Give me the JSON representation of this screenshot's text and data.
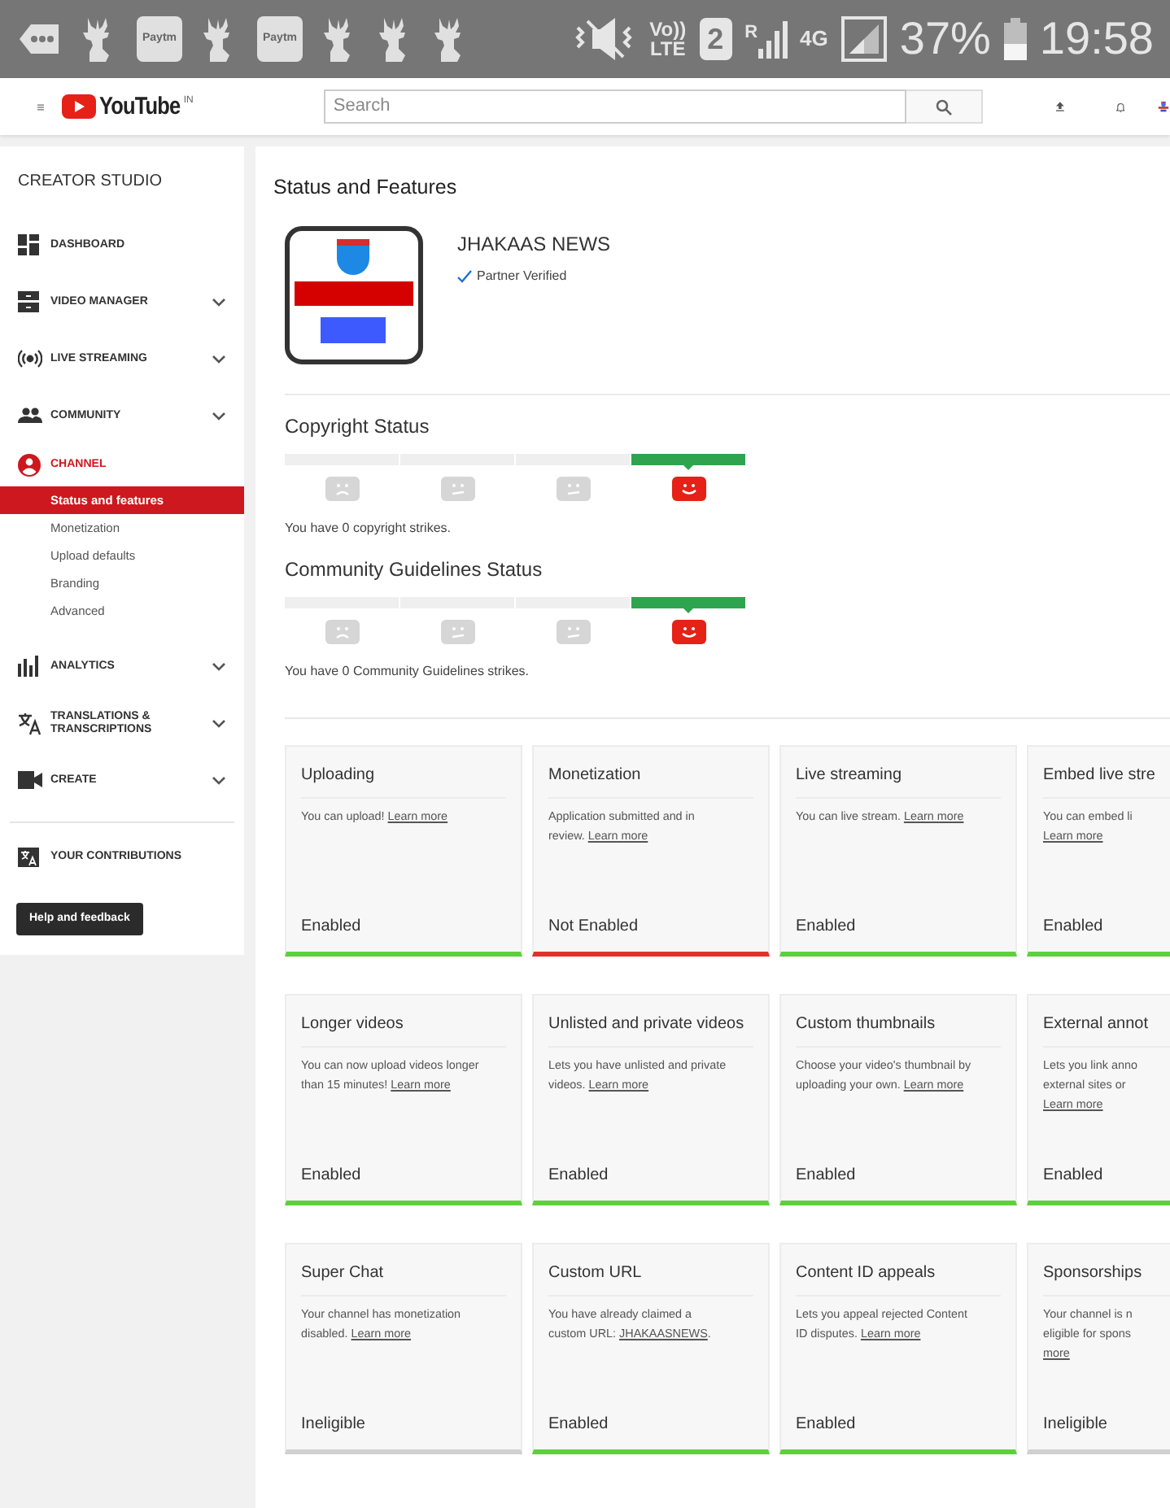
{
  "status_bar": {
    "notifications": [
      {
        "kind": "more"
      },
      {
        "kind": "deer"
      },
      {
        "kind": "paytm",
        "text": "Paytm"
      },
      {
        "kind": "deer"
      },
      {
        "kind": "paytm",
        "text": "Paytm"
      },
      {
        "kind": "deer"
      },
      {
        "kind": "deer"
      },
      {
        "kind": "deer"
      }
    ],
    "volte": [
      "Vo))",
      "LTE"
    ],
    "sim": "2",
    "roaming": "R",
    "network": "4G",
    "battery": "37%",
    "time": "19:58"
  },
  "header": {
    "logo": "YouTube",
    "region": "IN",
    "search": {
      "placeholder": "Search"
    }
  },
  "sidebar": {
    "title": "CREATOR STUDIO",
    "items": [
      {
        "label": "DASHBOARD",
        "expandable": false,
        "selected": false
      },
      {
        "label": "VIDEO MANAGER",
        "expandable": true,
        "selected": false
      },
      {
        "label": "LIVE STREAMING",
        "expandable": true,
        "selected": false
      },
      {
        "label": "COMMUNITY",
        "expandable": true,
        "selected": false
      },
      {
        "label": "CHANNEL",
        "expandable": false,
        "selected": true,
        "children": [
          {
            "label": "Status and features",
            "selected": true
          },
          {
            "label": "Monetization",
            "selected": false
          },
          {
            "label": "Upload defaults",
            "selected": false
          },
          {
            "label": "Branding",
            "selected": false
          },
          {
            "label": "Advanced",
            "selected": false
          }
        ]
      },
      {
        "label": "ANALYTICS",
        "expandable": true,
        "selected": false
      },
      {
        "label": "TRANSLATIONS & TRANSCRIPTIONS",
        "expandable": true,
        "selected": false
      },
      {
        "label": "CREATE",
        "expandable": true,
        "selected": false
      }
    ],
    "contributions": "YOUR CONTRIBUTIONS",
    "help_button": "Help and feedback"
  },
  "page": {
    "title": "Status and Features",
    "channel": {
      "name": "JHAKAAS NEWS",
      "verified": "Partner Verified"
    },
    "statuses": [
      {
        "title": "Copyright Status",
        "faces": [
          {
            "selected": false
          },
          {
            "selected": false
          },
          {
            "selected": false
          },
          {
            "selected": true
          }
        ],
        "note": "You have 0 copyright strikes."
      },
      {
        "title": "Community Guidelines Status",
        "faces": [
          {
            "selected": false
          },
          {
            "selected": false
          },
          {
            "selected": false
          },
          {
            "selected": true
          }
        ],
        "note": "You have 0 Community Guidelines strikes."
      }
    ],
    "features": [
      {
        "title": "Uploading",
        "lines": [
          [
            {
              "kind": "text",
              "text": "You can upload! "
            },
            {
              "kind": "link",
              "text": "Learn more"
            }
          ]
        ],
        "status": "Enabled",
        "kind": "enabled"
      },
      {
        "title": "Monetization",
        "lines": [
          [
            {
              "kind": "text",
              "text": "Application submitted and in"
            }
          ],
          [
            {
              "kind": "text",
              "text": "review. "
            },
            {
              "kind": "link",
              "text": "Learn more"
            }
          ]
        ],
        "status": "Not Enabled",
        "kind": "not_enabled"
      },
      {
        "title": "Live streaming",
        "lines": [
          [
            {
              "kind": "text",
              "text": "You can live stream. "
            },
            {
              "kind": "link",
              "text": "Learn more"
            }
          ]
        ],
        "status": "Enabled",
        "kind": "enabled"
      },
      {
        "title": "Embed live stre",
        "lines": [
          [
            {
              "kind": "text",
              "text": "You can embed li"
            }
          ],
          [
            {
              "kind": "link",
              "text": "Learn more"
            }
          ]
        ],
        "status": "Enabled",
        "kind": "enabled"
      },
      {
        "title": "Longer videos",
        "lines": [
          [
            {
              "kind": "text",
              "text": "You can now upload videos longer"
            }
          ],
          [
            {
              "kind": "text",
              "text": "than 15 minutes! "
            },
            {
              "kind": "link",
              "text": "Learn more"
            }
          ]
        ],
        "status": "Enabled",
        "kind": "enabled"
      },
      {
        "title": "Unlisted and private videos",
        "lines": [
          [
            {
              "kind": "text",
              "text": "Lets you have unlisted and private"
            }
          ],
          [
            {
              "kind": "text",
              "text": "videos. "
            },
            {
              "kind": "link",
              "text": "Learn more"
            }
          ]
        ],
        "status": "Enabled",
        "kind": "enabled"
      },
      {
        "title": "Custom thumbnails",
        "lines": [
          [
            {
              "kind": "text",
              "text": "Choose your video's thumbnail by"
            }
          ],
          [
            {
              "kind": "text",
              "text": "uploading your own. "
            },
            {
              "kind": "link",
              "text": "Learn more"
            }
          ]
        ],
        "status": "Enabled",
        "kind": "enabled"
      },
      {
        "title": "External annot",
        "lines": [
          [
            {
              "kind": "text",
              "text": "Lets you link anno"
            }
          ],
          [
            {
              "kind": "text",
              "text": "external sites or"
            }
          ],
          [
            {
              "kind": "link",
              "text": "Learn more"
            }
          ]
        ],
        "status": "Enabled",
        "kind": "enabled"
      },
      {
        "title": "Super Chat",
        "lines": [
          [
            {
              "kind": "text",
              "text": "Your channel has monetization"
            }
          ],
          [
            {
              "kind": "text",
              "text": "disabled. "
            },
            {
              "kind": "link",
              "text": "Learn more"
            }
          ]
        ],
        "status": "Ineligible",
        "kind": "ineligible"
      },
      {
        "title": "Custom URL",
        "lines": [
          [
            {
              "kind": "text",
              "text": "You have already claimed a"
            }
          ],
          [
            {
              "kind": "text",
              "text": "custom URL: "
            },
            {
              "kind": "link",
              "text": "JHAKAASNEWS"
            },
            {
              "kind": "text",
              "text": "."
            }
          ]
        ],
        "status": "Enabled",
        "kind": "enabled"
      },
      {
        "title": "Content ID appeals",
        "lines": [
          [
            {
              "kind": "text",
              "text": "Lets you appeal rejected Content"
            }
          ],
          [
            {
              "kind": "text",
              "text": "ID disputes. "
            },
            {
              "kind": "link",
              "text": "Learn more"
            }
          ]
        ],
        "status": "Enabled",
        "kind": "enabled"
      },
      {
        "title": "Sponsorships",
        "lines": [
          [
            {
              "kind": "text",
              "text": "Your channel is n"
            }
          ],
          [
            {
              "kind": "text",
              "text": "eligible for spons"
            }
          ],
          [
            {
              "kind": "link",
              "text": "more"
            }
          ]
        ],
        "status": "Ineligible",
        "kind": "ineligible"
      }
    ]
  }
}
